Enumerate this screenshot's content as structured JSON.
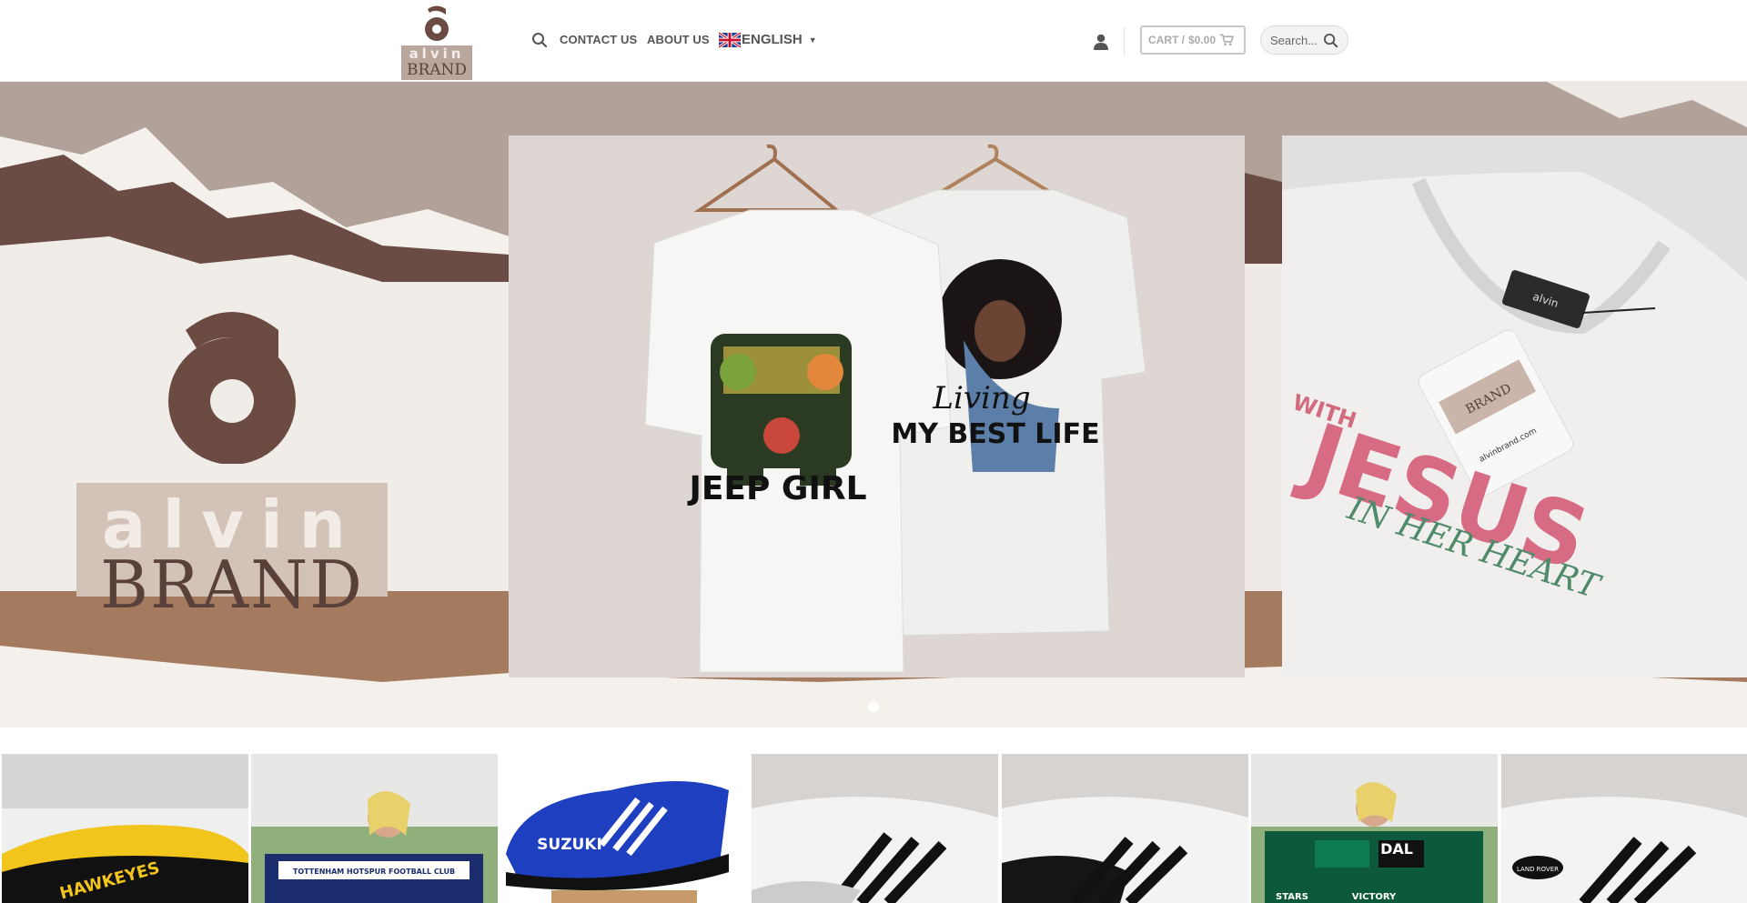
{
  "brand": {
    "name": "alvin BRAND",
    "word_top": "alvin",
    "word_bottom": "BRAND",
    "colors": {
      "brown": "#6b4a42",
      "plate": "#b9a79e",
      "cream": "#f3ece7"
    }
  },
  "header": {
    "nav": {
      "search_icon": "search-icon",
      "contact": "CONTACT US",
      "about": "ABOUT US",
      "language": "ENGLISH",
      "language_flag": "uk-flag-icon"
    },
    "account_icon": "user-icon",
    "cart": {
      "label": "CART /",
      "amount": "$0.00",
      "icon": "cart-icon"
    },
    "search": {
      "placeholder": "Search...",
      "icon": "search-icon"
    }
  },
  "hero": {
    "slides": [
      {
        "shirt_left_text": "JEEP GIRL",
        "shirt_right_script": "Living",
        "shirt_right_text": "MY BEST LIFE"
      },
      {
        "shirt_text": "JESUS",
        "shirt_text_prefix": "WITH",
        "shirt_subtext": "IN HER HEART",
        "tag_brand_top": "alvin",
        "tag_brand_bottom": "BRAND",
        "tag_url": "alvinbrand.com"
      }
    ],
    "active_dot": 1
  },
  "products": [
    {
      "name": "hawkeyes-shoe",
      "print_text": "HAWKEYES"
    },
    {
      "name": "tottenham-blanket",
      "print_text": "TOTTENHAM HOTSPUR FOOTBALL CLUB"
    },
    {
      "name": "suzuki-sneaker",
      "print_text": "SUZUKI"
    },
    {
      "name": "stripe-shoe-1",
      "print_text": ""
    },
    {
      "name": "stripe-shoe-2",
      "print_text": ""
    },
    {
      "name": "dallas-stars-blanket",
      "print_text_1": "DAL",
      "print_text_2": "STARS",
      "print_text_3": "VICTORY"
    },
    {
      "name": "land-rover-shoe",
      "print_text": "LAND ROVER"
    }
  ]
}
